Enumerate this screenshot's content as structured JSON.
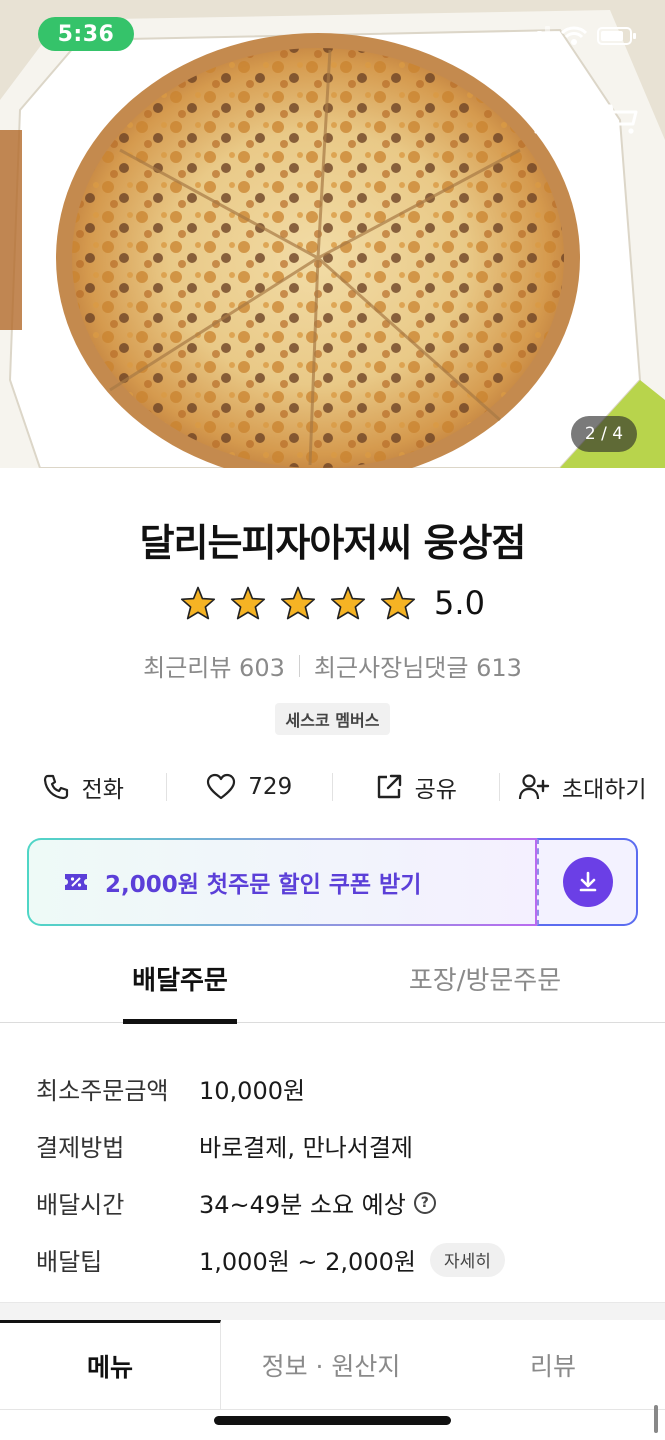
{
  "status_bar": {
    "time": "5:36"
  },
  "hero": {
    "photo_counter": "2 / 4",
    "photo_subject": "pizza-photo"
  },
  "store": {
    "name": "달리는피자아저씨 웅상점",
    "rating": "5.0",
    "stars": 5,
    "recent_reviews": "최근리뷰 603",
    "owner_replies": "최근사장님댓글 613",
    "badge": "세스코 멤버스"
  },
  "actions": {
    "call": "전화",
    "likes": "729",
    "share": "공유",
    "invite": "초대하기"
  },
  "coupon": {
    "text": "2,000원 첫주문 할인 쿠폰 받기"
  },
  "order_tabs": {
    "delivery": "배달주문",
    "pickup": "포장/방문주문"
  },
  "info": {
    "min_order_label": "최소주문금액",
    "min_order_value": "10,000원",
    "payment_label": "결제방법",
    "payment_value": "바로결제, 만나서결제",
    "time_label": "배달시간",
    "time_value": "34~49분 소요 예상",
    "tip_label": "배달팁",
    "tip_value": "1,000원 ~ 2,000원",
    "tip_detail": "자세히"
  },
  "bottom_tabs": {
    "menu": "메뉴",
    "info": "정보 · 원산지",
    "review": "리뷰"
  },
  "colors": {
    "accent": "#5b3fd8",
    "status_green": "#35c36a",
    "star": "#f5b324"
  }
}
